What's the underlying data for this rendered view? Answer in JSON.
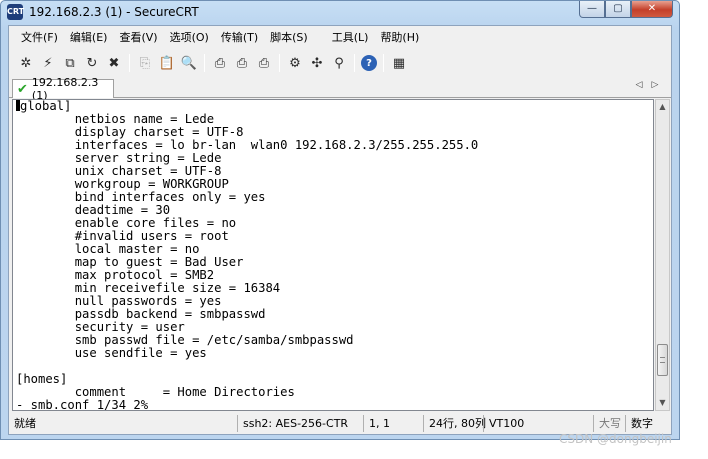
{
  "window": {
    "title": "192.168.2.3 (1) - SecureCRT",
    "app_icon_label": "CRT",
    "controls": {
      "minimize": "—",
      "maximize": "▢",
      "close": "✕"
    }
  },
  "menu": {
    "items": [
      "文件(F)",
      "编辑(E)",
      "查看(V)",
      "选项(O)",
      "传输(T)",
      "脚本(S)",
      "工具(L)",
      "帮助(H)"
    ]
  },
  "toolbar": {
    "icons": [
      {
        "name": "connect-icon",
        "glyph": "✲"
      },
      {
        "name": "quick-connect-icon",
        "glyph": "⚡"
      },
      {
        "name": "connect-tab-icon",
        "glyph": "⧉"
      },
      {
        "name": "reconnect-icon",
        "glyph": "↻"
      },
      {
        "name": "disconnect-icon",
        "glyph": "✖"
      },
      {
        "name": "copy-icon",
        "glyph": "⎘"
      },
      {
        "name": "paste-icon",
        "glyph": "📋"
      },
      {
        "name": "find-icon",
        "glyph": "🔍"
      },
      {
        "name": "print-icon",
        "glyph": "⎙"
      },
      {
        "name": "print-selection-icon",
        "glyph": "⎙"
      },
      {
        "name": "print-screen-icon",
        "glyph": "⎙"
      },
      {
        "name": "session-options-icon",
        "glyph": "⚙"
      },
      {
        "name": "global-options-icon",
        "glyph": "✣"
      },
      {
        "name": "keymap-icon",
        "glyph": "⚲"
      },
      {
        "name": "help-icon",
        "glyph": "?"
      },
      {
        "name": "sftp-icon",
        "glyph": "▦"
      }
    ]
  },
  "tab": {
    "label": "192.168.2.3 (1)",
    "prev": "◁",
    "next": "▷"
  },
  "terminal": {
    "lines": [
      "global]",
      "        netbios name = Lede",
      "        display charset = UTF-8",
      "        interfaces = lo br-lan  wlan0 192.168.2.3/255.255.255.0",
      "        server string = Lede",
      "        unix charset = UTF-8",
      "        workgroup = WORKGROUP",
      "        bind interfaces only = yes",
      "        deadtime = 30",
      "        enable core files = no",
      "        #invalid users = root",
      "        local master = no",
      "        map to guest = Bad User",
      "        max protocol = SMB2",
      "        min receivefile size = 16384",
      "        null passwords = yes",
      "        passdb backend = smbpasswd",
      "        security = user",
      "        smb passwd file = /etc/samba/smbpasswd",
      "        use sendfile = yes",
      "",
      "[homes]",
      "        comment     = Home Directories",
      "- smb.conf 1/34 2%"
    ]
  },
  "scrollbar": {
    "up": "▲",
    "down": "▼",
    "position_fraction": 0.92
  },
  "status": {
    "ready": "就绪",
    "protocol": "ssh2: AES-256-CTR",
    "cursor": "1,  1",
    "size": "24行, 80列",
    "terminal_type": "VT100",
    "caps": "大写",
    "num": "数字"
  },
  "watermark": "CSDN @dongbeijin"
}
